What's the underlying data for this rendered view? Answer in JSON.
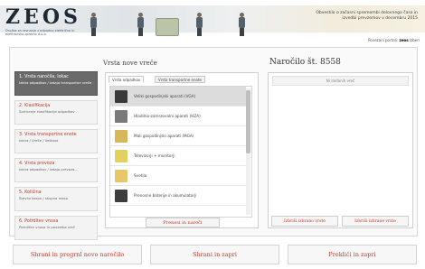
{
  "header": {
    "logo": "ZEOS",
    "logo_subtitle": "Družba za ravnanje z odpadno električno in elektronsko opremo d.o.o.",
    "notice": "Obvestilo o začasni spremembi delovnega časa in izvedbi prevzemov v decembru 2015",
    "lang_label": "Povezani portali:",
    "lang_current": "zeos",
    "lang_other": "Izberi"
  },
  "center": {
    "title": "Vrsta nove vreče",
    "tabs": [
      "Vrsta odpadkov",
      "Vrsta transportne enote"
    ],
    "items": [
      {
        "label": "Veliki gospodinjski aparati (VGA)",
        "icon": "fridge-icon",
        "color": "#3a3a3a"
      },
      {
        "label": "Hladilno-zamrzovalni aparati (HZA)",
        "icon": "freezer-icon",
        "color": "#7a7a7a"
      },
      {
        "label": "Mali gospodinjski aparati (MGA)",
        "icon": "appliance-icon",
        "color": "#d6b85a"
      },
      {
        "label": "Televizorji + monitorji",
        "icon": "tv-icon",
        "color": "#e2d15f"
      },
      {
        "label": "Svetila",
        "icon": "lamp-icon",
        "color": "#e8c76a"
      },
      {
        "label": "Prenosne baterije in akumulatorji",
        "icon": "battery-icon",
        "color": "#3d3d3d"
      }
    ],
    "add_button": "Prenesi in naroči"
  },
  "order": {
    "title": "Naročilo št. 8558",
    "empty_text": "Ni dodanih vreč",
    "remove_button": "Izbriši izbrano vrsto",
    "remove_all_button": "Izbriši izbrane vrste"
  },
  "steps": [
    {
      "title": "1. Vrsta naročila, lokac",
      "desc": "Izbira odpadkov / Izdaja transportne vreče",
      "active": true
    },
    {
      "title": "2. Klasifikacija",
      "desc": "Sortiranje klasifikacije odpadkov",
      "active": false
    },
    {
      "title": "3. Vrsta transportne enote",
      "desc": "Izbira / Vreče / Velikost",
      "active": false
    },
    {
      "title": "4. Vrsta prevoza",
      "desc": "Izbira odpadkov / Izdaja prevoza...",
      "active": false
    },
    {
      "title": "5. Količina",
      "desc": "Število kosov / skupna masa",
      "active": false
    },
    {
      "title": "6. Potrditev vnosa",
      "desc": "Potrditev vnosa in povzetka vreč",
      "active": false
    }
  ],
  "footer": {
    "btn1": "Shrani in pregrnl novo naročilo",
    "btn2": "Shrani in zapri",
    "btn3": "Prekliči in zapri"
  }
}
